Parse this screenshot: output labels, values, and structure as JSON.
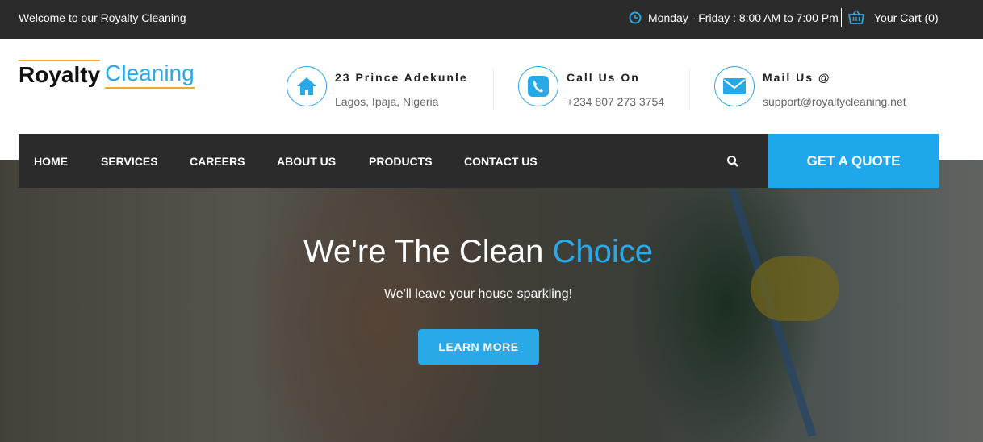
{
  "topbar": {
    "welcome": "Welcome to our Royalty Cleaning",
    "hours": "Monday - Friday : 8:00 AM to 7:00 Pm",
    "cart": "Your Cart (0)"
  },
  "logo": {
    "part1": "Royalty",
    "part2": "Cleaning"
  },
  "contact": {
    "address_title": "23 Prince Adekunle",
    "address_sub": "Lagos, Ipaja, Nigeria",
    "phone_title": "Call Us On",
    "phone_sub": "+234 807 273 3754",
    "mail_title": "Mail Us @",
    "mail_sub": "support@royaltycleaning.net"
  },
  "nav": {
    "items": [
      "HOME",
      "SERVICES",
      "CAREERS",
      "ABOUT US",
      "PRODUCTS",
      "CONTACT US"
    ],
    "quote": "GET A QUOTE"
  },
  "hero": {
    "title_main": "We're The Clean ",
    "title_accent": "Choice",
    "tagline": "We'll leave your house sparkling!",
    "button": "LEARN MORE"
  },
  "colors": {
    "accent": "#29a9e7",
    "dark": "#2b2b2b",
    "logo_line": "#f5a623"
  },
  "icons": [
    "clock-icon",
    "cart-icon",
    "home-icon",
    "phone-icon",
    "mail-icon",
    "search-icon"
  ]
}
